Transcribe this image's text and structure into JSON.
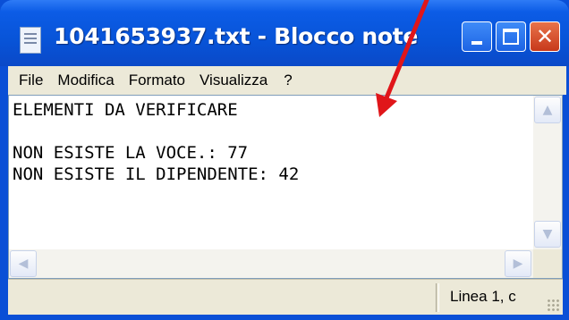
{
  "window": {
    "title": "1041653937.txt - Blocco note",
    "buttons": {
      "minimize": "minimize",
      "maximize": "maximize",
      "close": "✕"
    }
  },
  "menu": {
    "items": [
      "File",
      "Modifica",
      "Formato",
      "Visualizza",
      "?"
    ]
  },
  "document": {
    "text": "ELEMENTI DA VERIFICARE\n\nNON ESISTE LA VOCE.: 77\nNON ESISTE IL DIPENDENTE: 42"
  },
  "statusbar": {
    "position": "Linea 1, c"
  },
  "colors": {
    "titlebar": "#0854d8",
    "annotation_arrow": "#e0161a"
  },
  "icons": {
    "app": "notepad-icon",
    "scroll_up": "scroll-up-arrow-icon",
    "scroll_down": "scroll-down-arrow-icon",
    "scroll_left": "scroll-left-arrow-icon",
    "scroll_right": "scroll-right-arrow-icon",
    "grip": "resize-grip-icon",
    "annotation": "red-arrow-icon"
  }
}
